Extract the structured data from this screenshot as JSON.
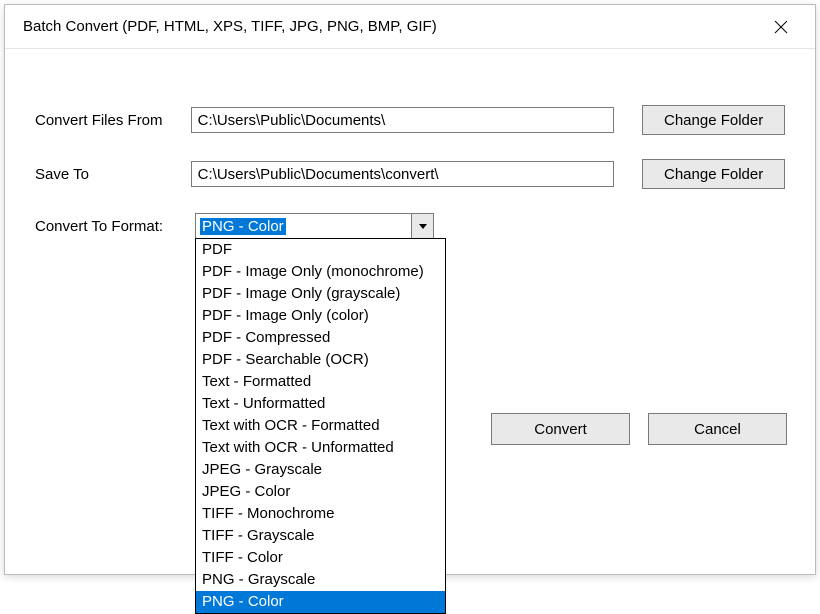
{
  "window": {
    "title": "Batch Convert (PDF, HTML, XPS, TIFF, JPG, PNG, BMP, GIF)"
  },
  "labels": {
    "convertFrom": "Convert Files From",
    "saveTo": "Save To",
    "convertFormat": "Convert To Format:"
  },
  "fields": {
    "convertFrom": "C:\\Users\\Public\\Documents\\",
    "saveTo": "C:\\Users\\Public\\Documents\\convert\\",
    "formatSelected": "PNG - Color"
  },
  "buttons": {
    "changeFolder1": "Change Folder",
    "changeFolder2": "Change Folder",
    "convert": "Convert",
    "cancel": "Cancel"
  },
  "formatOptions": [
    "PDF",
    "PDF - Image Only (monochrome)",
    "PDF - Image Only (grayscale)",
    "PDF - Image Only (color)",
    "PDF - Compressed",
    "PDF - Searchable (OCR)",
    "Text - Formatted",
    "Text - Unformatted",
    "Text with OCR - Formatted",
    "Text with OCR - Unformatted",
    "JPEG - Grayscale",
    "JPEG - Color",
    "TIFF - Monochrome",
    "TIFF - Grayscale",
    "TIFF - Color",
    "PNG - Grayscale",
    "PNG - Color"
  ],
  "selectedOptionIndex": 16
}
